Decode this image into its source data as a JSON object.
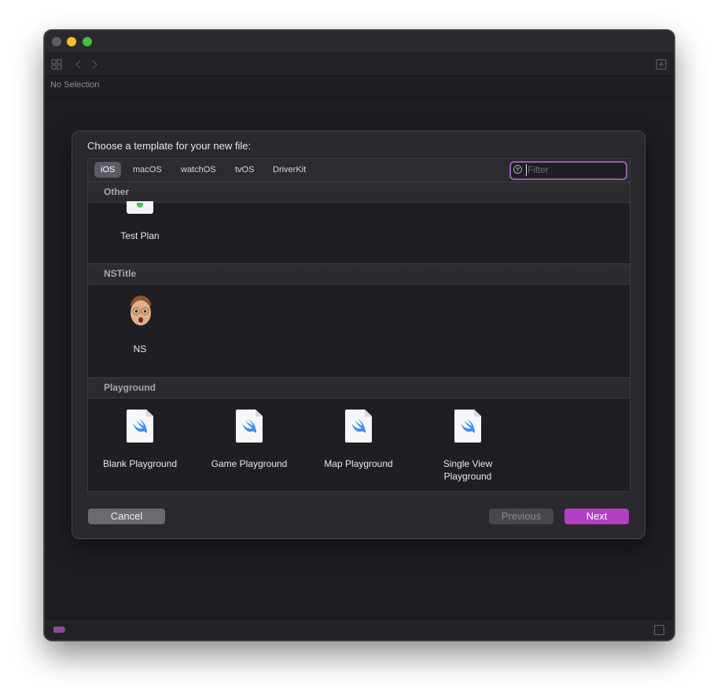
{
  "window": {
    "no_selection": "No Selection"
  },
  "dialog": {
    "title": "Choose a template for your new file:",
    "platform_tabs": [
      {
        "label": "iOS",
        "active": true
      },
      {
        "label": "macOS",
        "active": false
      },
      {
        "label": "watchOS",
        "active": false
      },
      {
        "label": "tvOS",
        "active": false
      },
      {
        "label": "DriverKit",
        "active": false
      }
    ],
    "filter": {
      "placeholder": "Filter",
      "value": ""
    },
    "sections": [
      {
        "title": "Other",
        "items": [
          {
            "label": "Test Plan",
            "icon": "test-plan-icon"
          }
        ]
      },
      {
        "title": "NSTitle",
        "items": [
          {
            "label": "NS",
            "icon": "memoji-avatar-icon"
          }
        ]
      },
      {
        "title": "Playground",
        "items": [
          {
            "label": "Blank Playground",
            "icon": "swift-file-icon"
          },
          {
            "label": "Game Playground",
            "icon": "swift-file-icon"
          },
          {
            "label": "Map Playground",
            "icon": "swift-file-icon"
          },
          {
            "label": "Single View Playground",
            "icon": "swift-file-icon"
          }
        ]
      }
    ],
    "buttons": {
      "cancel": "Cancel",
      "previous": "Previous",
      "next": "Next"
    }
  },
  "colors": {
    "accent": "#b23fc4",
    "swift": "#3d8ef0",
    "check": "#34c759"
  }
}
